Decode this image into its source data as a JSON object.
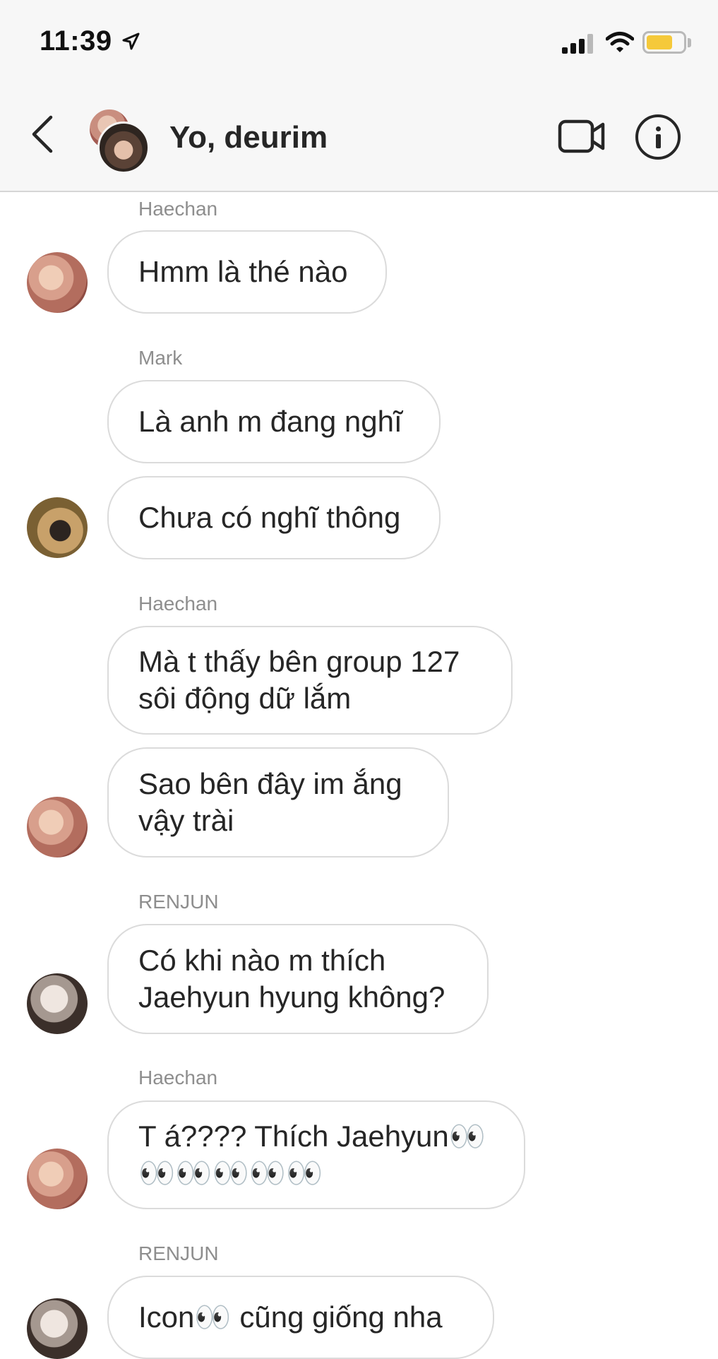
{
  "status_bar": {
    "time": "11:39"
  },
  "header": {
    "title": "Yo, deurim"
  },
  "messages": [
    {
      "sender": "Haechan",
      "text": "Hmm là thé nào"
    },
    {
      "sender": "Mark",
      "text": "Là anh m đang nghĩ"
    },
    {
      "text": "Chưa có nghĩ thông"
    },
    {
      "sender": "Haechan",
      "text": "Mà t thấy bên group 127\nsôi động dữ lắm"
    },
    {
      "text": "Sao bên đây im ắng\nvậy trài"
    },
    {
      "sender": "RENJUN",
      "text": "Có khi nào m thích\nJaehyun hyung không?"
    },
    {
      "sender": "Haechan",
      "text": "T á???? Thích Jaehyun👀\n👀👀👀👀👀"
    },
    {
      "sender": "RENJUN",
      "text": "Icon👀 cũng giống nha"
    }
  ],
  "colors": {
    "header_bg": "#f7f7f7",
    "bubble_border": "#dbdbdb",
    "sender_text": "#8e8e8e",
    "battery": "#f5c93a"
  },
  "icons": [
    "location-arrow-icon",
    "signal-icon",
    "wifi-icon",
    "battery-icon",
    "back-chevron-icon",
    "video-camera-icon",
    "info-icon"
  ]
}
